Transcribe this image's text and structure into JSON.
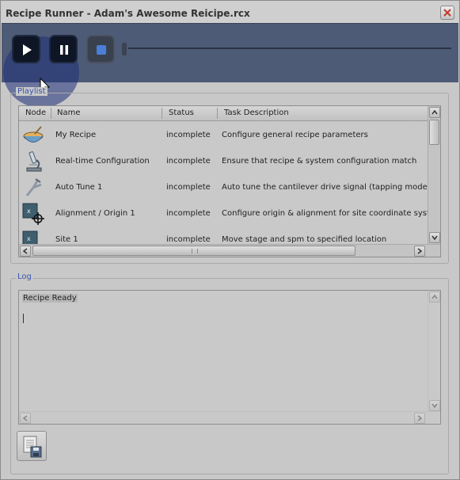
{
  "window": {
    "title": "Recipe Runner - Adam's Awesome Reicipe.rcx"
  },
  "toolbar": {
    "play_icon": "play-icon",
    "pause_icon": "pause-icon",
    "stop_icon": "stop-icon"
  },
  "playlist": {
    "title": "Playlist",
    "columns": [
      "Node",
      "Name",
      "Status",
      "Task Description"
    ],
    "rows": [
      {
        "icon": "bowl-icon",
        "name": "My Recipe",
        "status": "incomplete",
        "description": "Configure general recipe parameters"
      },
      {
        "icon": "microscope-icon",
        "name": "Real-time Configuration",
        "status": "incomplete",
        "description": "Ensure that recipe & system configuration match"
      },
      {
        "icon": "tuning-fork-icon",
        "name": "Auto Tune 1",
        "status": "incomplete",
        "description": "Auto tune the cantilever drive signal (tapping mode on"
      },
      {
        "icon": "crosshair-icon",
        "name": "Alignment / Origin 1",
        "status": "incomplete",
        "description": "Configure origin & alignment for site coordinate system"
      },
      {
        "icon": "site-icon",
        "name": "Site 1",
        "status": "incomplete",
        "description": "Move stage and spm to specified location"
      }
    ]
  },
  "log": {
    "title": "Log",
    "text": "Recipe Ready"
  },
  "colors": {
    "toolbar_bg": "#4e5b76",
    "group_title": "#3a53a8",
    "window_bg": "#c8c8c8"
  }
}
